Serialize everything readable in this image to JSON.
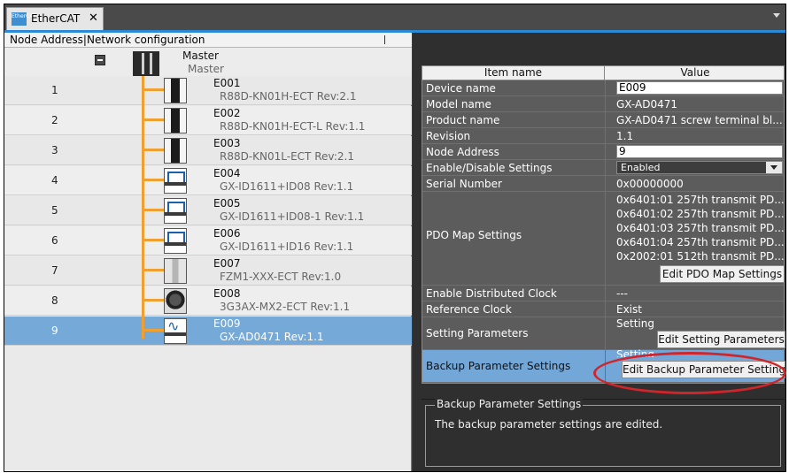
{
  "tab": {
    "icon_name": "ethercat-icon",
    "icon_text": "EtherCAT",
    "label": "EtherCAT",
    "close_glyph": "✕"
  },
  "left": {
    "header": "Node Address|Network configuration",
    "master": {
      "name": "Master",
      "subtitle": "Master"
    },
    "nodes": [
      {
        "addr": "1",
        "name": "E001",
        "model": "R88D-KN01H-ECT Rev:2.1",
        "icon": "servo-drive-icon"
      },
      {
        "addr": "2",
        "name": "E002",
        "model": "R88D-KN01H-ECT-L Rev:1.1",
        "icon": "servo-drive-icon"
      },
      {
        "addr": "3",
        "name": "E003",
        "model": "R88D-KN01L-ECT Rev:2.1",
        "icon": "servo-drive-icon"
      },
      {
        "addr": "4",
        "name": "E004",
        "model": "GX-ID1611+ID08 Rev:1.1",
        "icon": "digital-io-icon"
      },
      {
        "addr": "5",
        "name": "E005",
        "model": "GX-ID1611+ID08-1 Rev:1.1",
        "icon": "digital-io-icon"
      },
      {
        "addr": "6",
        "name": "E006",
        "model": "GX-ID1611+ID16 Rev:1.1",
        "icon": "digital-io-icon"
      },
      {
        "addr": "7",
        "name": "E007",
        "model": "FZM1-XXX-ECT Rev:1.0",
        "icon": "vision-sensor-icon"
      },
      {
        "addr": "8",
        "name": "E008",
        "model": "3G3AX-MX2-ECT Rev:1.1",
        "icon": "inverter-icon"
      },
      {
        "addr": "9",
        "name": "E009",
        "model": "GX-AD0471 Rev:1.1",
        "icon": "analog-input-icon"
      }
    ]
  },
  "grid": {
    "headers": {
      "item": "Item name",
      "value": "Value"
    },
    "device_name": {
      "label": "Device name",
      "value": "E009"
    },
    "model_name": {
      "label": "Model name",
      "value": "GX-AD0471"
    },
    "product_name": {
      "label": "Product name",
      "value": "GX-AD0471 screw terminal bl..."
    },
    "revision": {
      "label": "Revision",
      "value": "1.1"
    },
    "node_address": {
      "label": "Node Address",
      "value": "9"
    },
    "enable_disable": {
      "label": "Enable/Disable Settings",
      "value": "Enabled"
    },
    "serial_number": {
      "label": "Serial Number",
      "value": "0x00000000"
    },
    "pdo": {
      "label": "PDO Map Settings",
      "lines": [
        "0x6401:01 257th transmit PD...",
        "0x6401:02 257th transmit PD...",
        "0x6401:03 257th transmit PD...",
        "0x6401:04 257th transmit PD...",
        "0x2002:01 512th transmit PD..."
      ],
      "button": "Edit PDO Map Settings"
    },
    "dist_clock": {
      "label": "Enable Distributed Clock",
      "value": "---"
    },
    "ref_clock": {
      "label": "Reference Clock",
      "value": "Exist"
    },
    "setting_params": {
      "label": "Setting Parameters",
      "value": "Setting",
      "button": "Edit Setting Parameters"
    },
    "backup_params": {
      "label": "Backup Parameter Settings",
      "value": "Setting",
      "button": "Edit Backup Parameter Setting"
    }
  },
  "description": {
    "title": "Backup Parameter Settings",
    "text": "The backup parameter settings are edited."
  },
  "colors": {
    "accent": "#2b8ad6",
    "selection": "#74a9d8",
    "trunk": "#f0a030",
    "highlight": "#d0252a"
  }
}
